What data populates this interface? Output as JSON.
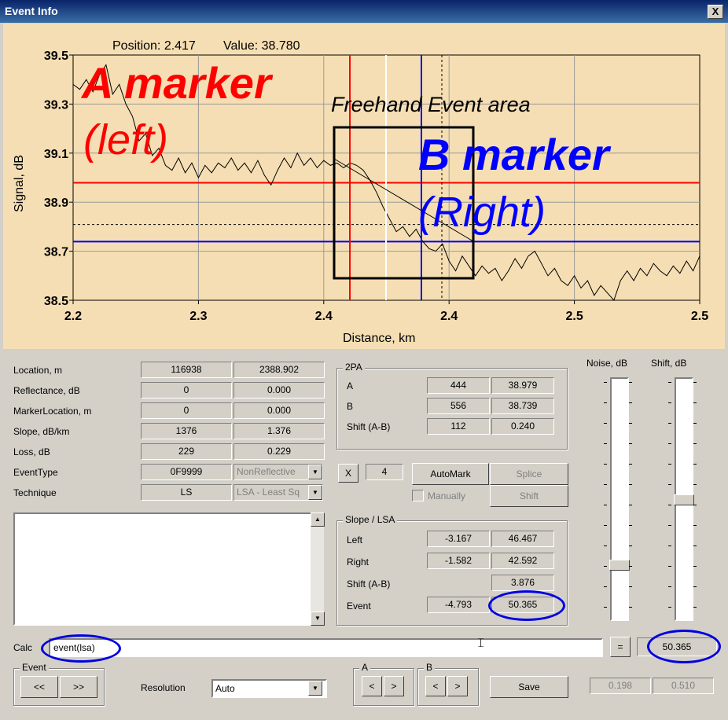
{
  "window": {
    "title": "Event Info",
    "close_glyph": "X"
  },
  "chart": {
    "readout_position": "Position: 2.417",
    "readout_value": "Value: 38.780",
    "ylabel": "Signal, dB",
    "xlabel": "Distance, km",
    "annotations": {
      "a_marker": "A marker",
      "a_sub": "(left)",
      "freehand": "Freehand Event area",
      "b_marker": "B marker",
      "b_sub": "(Right)"
    },
    "colors": {
      "background": "#f5deb3",
      "a_marker": "#ff0000",
      "b_marker": "#0000ff",
      "annotation_red": "#ff0000",
      "annotation_blue": "#0000ff"
    }
  },
  "chart_data": {
    "type": "line",
    "xlabel": "Distance, km",
    "ylabel": "Signal, dB",
    "x_tick_labels": [
      "2.2",
      "2.3",
      "2.4",
      "2.4",
      "2.5",
      "2.5"
    ],
    "y_tick_labels": [
      "39.5",
      "39.3",
      "39.1",
      "38.9",
      "38.7",
      "38.5"
    ],
    "xlim": [
      2.2,
      2.5
    ],
    "ylim": [
      38.5,
      39.5
    ],
    "grid": true,
    "markers": {
      "A_x": 2.433,
      "B_x": 2.47,
      "white_x": 2.45,
      "A_level": 38.979,
      "B_level": 38.739
    },
    "series": [
      {
        "x": [
          2.2,
          2.205,
          2.21,
          2.215,
          2.22,
          2.225,
          2.23,
          2.235,
          2.24,
          2.245,
          2.25,
          2.255,
          2.26,
          2.265,
          2.27,
          2.275,
          2.28,
          2.285,
          2.29,
          2.295,
          2.3,
          2.305,
          2.31,
          2.315,
          2.32,
          2.325,
          2.33,
          2.335,
          2.34,
          2.345,
          2.35,
          2.355,
          2.36,
          2.365,
          2.37,
          2.375,
          2.38,
          2.385,
          2.39,
          2.395,
          2.4,
          2.405,
          2.41,
          2.415,
          2.42,
          2.43,
          2.44,
          2.45,
          2.46,
          2.47,
          2.475,
          2.48,
          2.485,
          2.49,
          2.495,
          2.5,
          2.505,
          2.51,
          2.515,
          2.52,
          2.525,
          2.53,
          2.535,
          2.54,
          2.545,
          2.55,
          2.555,
          2.56,
          2.565,
          2.57,
          2.575,
          2.58,
          2.585,
          2.59,
          2.595,
          2.6,
          2.605,
          2.61,
          2.615,
          2.62,
          2.625,
          2.63,
          2.635,
          2.64,
          2.645,
          2.65,
          2.655,
          2.66,
          2.665,
          2.67,
          2.675,
          2.68,
          2.685,
          2.69,
          2.695,
          2.7
        ],
        "y": [
          39.38,
          39.36,
          39.4,
          39.35,
          39.42,
          39.46,
          39.34,
          39.38,
          39.3,
          39.25,
          39.15,
          39.18,
          39.09,
          39.12,
          39.05,
          39.03,
          39.08,
          39.02,
          39.06,
          39.0,
          39.05,
          39.02,
          39.06,
          39.04,
          39.08,
          39.03,
          39.06,
          39.02,
          39.07,
          39.01,
          38.97,
          39.03,
          39.08,
          39.04,
          39.1,
          39.05,
          39.08,
          39.04,
          39.07,
          39.05,
          39.06,
          39.04,
          39.06,
          39.05,
          39.03,
          38.99,
          38.94,
          38.88,
          38.83,
          38.78,
          38.8,
          38.76,
          38.79,
          38.74,
          38.71,
          38.7,
          38.73,
          38.66,
          38.62,
          38.68,
          38.64,
          38.6,
          38.64,
          38.61,
          38.63,
          38.58,
          38.62,
          38.67,
          38.63,
          38.68,
          38.7,
          38.65,
          38.6,
          38.63,
          38.58,
          38.56,
          38.6,
          38.55,
          38.58,
          38.52,
          38.56,
          38.53,
          38.49,
          38.58,
          38.62,
          38.58,
          38.63,
          38.6,
          38.65,
          38.62,
          38.6,
          38.64,
          38.61,
          38.66,
          38.62,
          38.68
        ]
      }
    ]
  },
  "params": {
    "rows": [
      {
        "label": "Location, m",
        "v1": "116938",
        "v2": "2388.902"
      },
      {
        "label": "Reflectance, dB",
        "v1": "0",
        "v2": "0.000"
      },
      {
        "label": "MarkerLocation, m",
        "v1": "0",
        "v2": "0.000"
      },
      {
        "label": "Slope, dB/km",
        "v1": "1376",
        "v2": "1.376"
      },
      {
        "label": "Loss, dB",
        "v1": "229",
        "v2": "0.229"
      },
      {
        "label": "EventType",
        "v1": "0F9999",
        "v2": "NonReflective"
      },
      {
        "label": "Technique",
        "v1": "LS",
        "v2": "LSA - Least Sq"
      }
    ]
  },
  "twopa": {
    "title": "2PA",
    "rows": [
      {
        "label": "A",
        "v1": "444",
        "v2": "38.979"
      },
      {
        "label": "B",
        "v1": "556",
        "v2": "38.739"
      },
      {
        "label": "Shift (A-B)",
        "v1": "112",
        "v2": "0.240"
      }
    ]
  },
  "controls": {
    "x_button": "X",
    "x_value": "4",
    "automark": "AutoMark",
    "splice": "Splice",
    "manually": "Manually",
    "shift": "Shift"
  },
  "slope": {
    "title": "Slope / LSA",
    "rows": [
      {
        "label": "Left",
        "v1": "-3.167",
        "v2": "46.467"
      },
      {
        "label": "Right",
        "v1": "-1.582",
        "v2": "42.592"
      },
      {
        "label": "Shift (A-B)",
        "v1": "",
        "v2": "3.876"
      },
      {
        "label": "Event",
        "v1": "-4.793",
        "v2": "50.365"
      }
    ]
  },
  "sliders": {
    "noise_label": "Noise, dB",
    "shift_label": "Shift, dB",
    "noise_level": 0.1,
    "shift_level": 0.5
  },
  "calc": {
    "label": "Calc",
    "expression": "event(lsa)",
    "equals": "=",
    "result": "50.365"
  },
  "bottom": {
    "event_title": "Event",
    "prev": "<<",
    "next": ">>",
    "resolution_label": "Resolution",
    "resolution_value": "Auto",
    "a_title": "A",
    "b_title": "B",
    "left": "<",
    "right": ">",
    "save": "Save",
    "out1": "0.198",
    "out2": "0.510"
  },
  "icons": {
    "combo_arrow": "chevron-down-icon",
    "scroll_up": "scroll-up-icon",
    "scroll_down": "scroll-down-icon"
  }
}
